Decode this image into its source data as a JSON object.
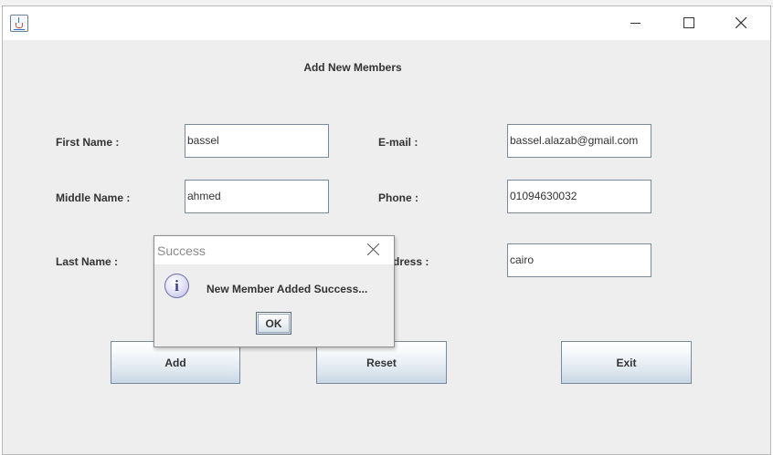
{
  "window": {
    "min_glyph": "—",
    "max_glyph": "☐",
    "close_glyph": "✕"
  },
  "form": {
    "title": "Add New Members",
    "labels": {
      "first_name": "First Name :",
      "middle_name": "Middle Name :",
      "last_name": "Last Name :",
      "email": "E-mail :",
      "phone": "Phone :",
      "address": "Address :"
    },
    "values": {
      "first_name": "bassel",
      "middle_name": "ahmed",
      "email": "bassel.alazab@gmail.com",
      "phone": "01094630032",
      "address": "cairo"
    },
    "buttons": {
      "add": "Add",
      "reset": "Reset",
      "exit": "Exit"
    }
  },
  "dialog": {
    "title": "Success",
    "message": "New Member Added Success...",
    "ok_label": "OK",
    "icon": "info-icon"
  },
  "colors": {
    "window_bg": "#eeeeee",
    "text": "#333333",
    "field_border": "#7a8a99",
    "info_icon_fill": "#b8b8e2"
  }
}
